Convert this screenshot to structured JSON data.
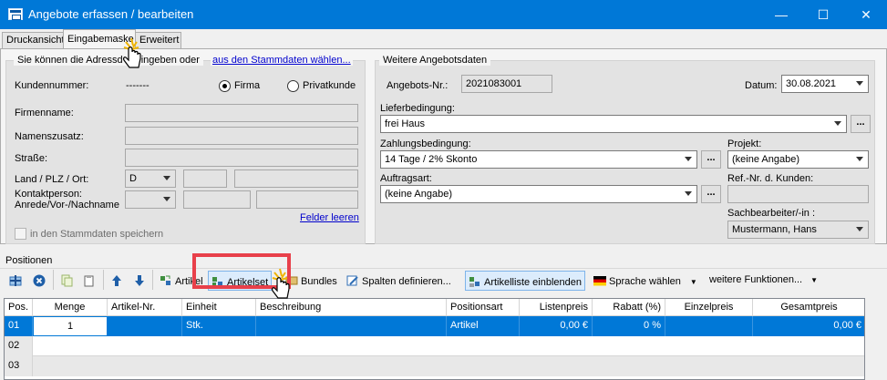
{
  "window": {
    "title": "Angebote erfassen / bearbeiten",
    "min_glyph": "—",
    "max_glyph": "☐",
    "close_glyph": "✕"
  },
  "tabs": [
    "Druckansicht",
    "Eingabemaske",
    "Erweitert"
  ],
  "address": {
    "group_text": "Sie können die Adressd",
    "group_text2": "eingeben oder",
    "group_link": "aus den Stammdaten wählen...",
    "kundennummer_label": "Kundennummer:",
    "kundennummer_value": "-------",
    "radio_firma": "Firma",
    "radio_privat": "Privatkunde",
    "firmenname_label": "Firmenname:",
    "namenszusatz_label": "Namenszusatz:",
    "strasse_label": "Straße:",
    "land_label": "Land / PLZ / Ort:",
    "land_value": "D",
    "kontakt_label1": "Kontaktperson:",
    "kontakt_label2": "Anrede/Vor-/Nachname",
    "felder_leeren": "Felder leeren",
    "save_checkbox": "in den Stammdaten speichern"
  },
  "offer": {
    "group_title": "Weitere Angebotsdaten",
    "nr_label": "Angebots-Nr.:",
    "nr_value": "2021083001",
    "datum_label": "Datum:",
    "datum_value": "30.08.2021",
    "liefer_label": "Lieferbedingung:",
    "liefer_value": "frei Haus",
    "zahlung_label": "Zahlungsbedingung:",
    "zahlung_value": "14 Tage / 2% Skonto",
    "projekt_label": "Projekt:",
    "projekt_value": "(keine Angabe)",
    "auftrag_label": "Auftragsart:",
    "auftrag_value": "(keine Angabe)",
    "refnr_label": "Ref.-Nr. d. Kunden:",
    "sachb_label": "Sachbearbeiter/-in :",
    "sachb_value": "Mustermann, Hans",
    "dots": "..."
  },
  "positions": {
    "section_label": "Positionen",
    "toolbar": {
      "artikel": "Artikel",
      "artikelset": "Artikelset",
      "bundles": "Bundles",
      "spalten": "Spalten definieren...",
      "artikelliste": "Artikelliste einblenden",
      "sprache": "Sprache wählen",
      "weitere": "weitere Funktionen..."
    },
    "columns": [
      "Pos.",
      "Menge",
      "Artikel-Nr.",
      "Einheit",
      "Beschreibung",
      "Positionsart",
      "Listenpreis",
      "Rabatt (%)",
      "Einzelpreis",
      "Gesamtpreis"
    ],
    "rows": [
      {
        "pos": "01",
        "menge": "1",
        "artikelnr": "",
        "einheit": "Stk.",
        "beschreibung": "",
        "art": "Artikel",
        "listenpreis": "0,00 €",
        "rabatt": "0 %",
        "einzelpreis": "",
        "gesamtpreis": "0,00 €"
      },
      {
        "pos": "02"
      },
      {
        "pos": "03"
      }
    ]
  },
  "colors": {
    "titlebar": "#0078d7",
    "selection": "#0078d7",
    "annotation": "#e8404a"
  }
}
